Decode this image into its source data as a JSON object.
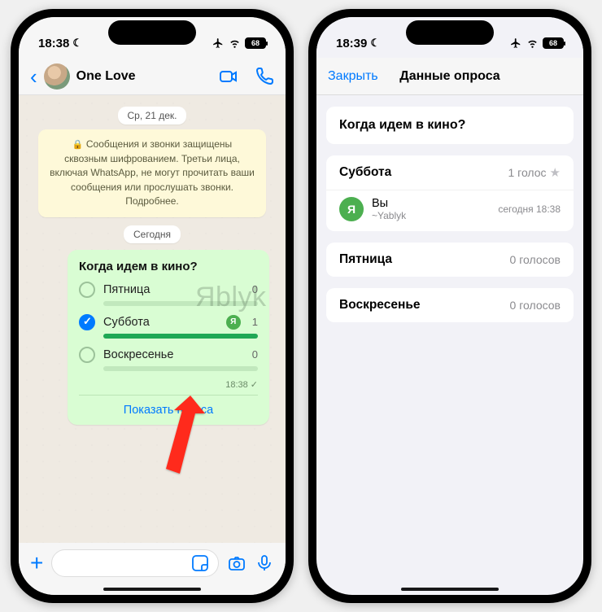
{
  "status": {
    "left_time": "18:38",
    "right_time": "18:39",
    "battery": "68"
  },
  "chat": {
    "title": "One Love",
    "date_pill": "Ср, 21 дек.",
    "encryption_banner": "Сообщения и звонки защищены сквозным шифрованием. Третьи лица, включая WhatsApp, не могут прочитать ваши сообщения или прослушать звонки. Подробнее.",
    "today_pill": "Сегодня",
    "msg_time": "18:38"
  },
  "poll": {
    "question": "Когда идем в кино?",
    "options": [
      {
        "label": "Пятница",
        "count": "0",
        "checked": false,
        "fill": 0
      },
      {
        "label": "Суббота",
        "count": "1",
        "checked": true,
        "fill": 100
      },
      {
        "label": "Воскресенье",
        "count": "0",
        "checked": false,
        "fill": 0
      }
    ],
    "show_votes": "Показать голоса"
  },
  "results": {
    "close": "Закрыть",
    "title": "Данные опроса",
    "question": "Когда идем в кино?",
    "options": [
      {
        "name": "Суббота",
        "count_label": "1 голос",
        "starred": true,
        "voters": [
          {
            "initial": "Я",
            "name": "Вы",
            "sub": "~Yablyk",
            "time": "сегодня 18:38"
          }
        ]
      },
      {
        "name": "Пятница",
        "count_label": "0 голосов",
        "starred": false,
        "voters": []
      },
      {
        "name": "Воскресенье",
        "count_label": "0 голосов",
        "starred": false,
        "voters": []
      }
    ]
  },
  "watermark": "Яblyk"
}
